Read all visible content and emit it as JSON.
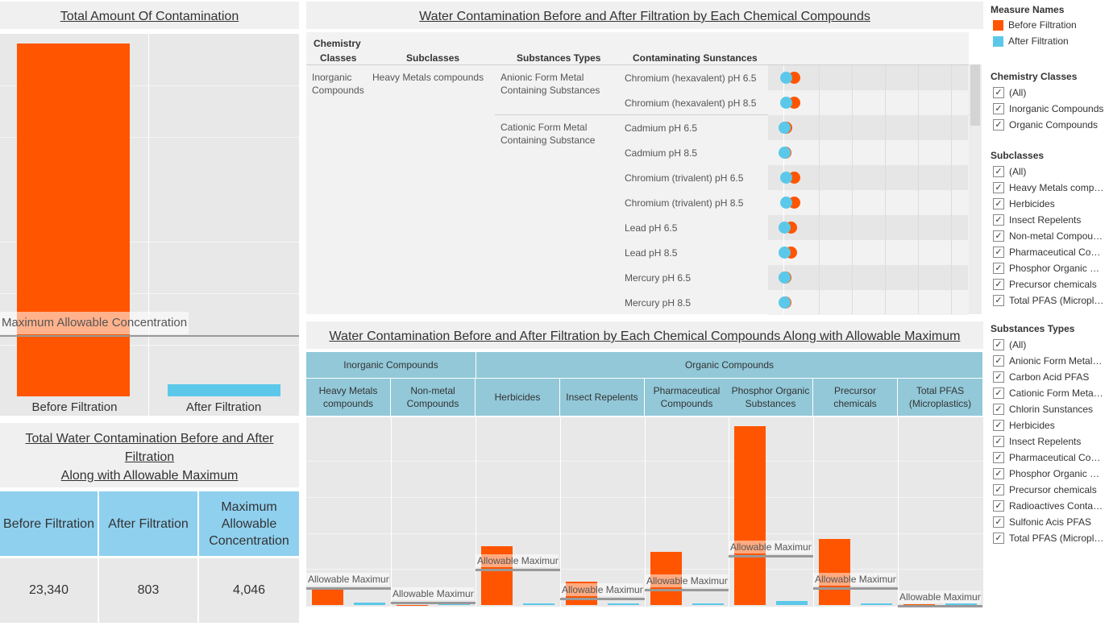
{
  "colors": {
    "before": "#ff5500",
    "after": "#5bc8ea",
    "reference": "#999999",
    "header": "#92c8d8",
    "table_header": "#8fd0ef"
  },
  "panel1": {
    "title": "Total Amount Of Contamination",
    "ref_label": "Maximum Allowable Concentration"
  },
  "panel2": {
    "title": "Water Contamination Before and After Filtration by Each Chemical Compounds",
    "headers": {
      "chem_class_1": "Chemistry",
      "chem_class_2": "Classes",
      "subclass": "Subclasses",
      "sub_type": "Substances Types",
      "contaminating": "Contaminating Sunstances"
    },
    "chem_class_1": "Inorganic",
    "chem_class_2": "Compounds",
    "subclass": "Heavy Metals compounds",
    "type_anionic_1": "Anionic Form Metal",
    "type_anionic_2": "Containing Substances",
    "type_cationic_1": "Cationic Form Metal",
    "type_cationic_2": "Containing Substance"
  },
  "panel3": {
    "title": "Water Contamination Before and After Filtration by Each Chemical Compounds Along with Allowable Maximum",
    "class_inorganic": "Inorganic Compounds",
    "class_organic": "Organic Compounds",
    "ref_label": "Allowable Maximum"
  },
  "panel4": {
    "title_line1": "Total Water Contamination Before and After",
    "title_line2": "Filtration",
    "title_line3": "Along with Allowable Maximum",
    "headers": [
      "Before Filtration",
      "After Filtration",
      "Maximum Allowable Concentration"
    ],
    "values": [
      "23,340",
      "803",
      "4,046"
    ]
  },
  "legend": {
    "title": "Measure Names",
    "items": [
      "Before Filtration",
      "After Filtration"
    ]
  },
  "filters": {
    "chemistry_classes": {
      "title": "Chemistry Classes",
      "items": [
        "(All)",
        "Inorganic Compounds",
        "Organic Compounds"
      ]
    },
    "subclasses": {
      "title": "Subclasses",
      "items": [
        "(All)",
        "Heavy Metals compounds",
        "Herbicides",
        "Insect Repelents",
        "Non-metal Compounds",
        "Pharmaceutical Compounds",
        "Phosphor Organic Substances",
        "Precursor chemicals",
        "Total PFAS (Microplastics)"
      ]
    },
    "substances_types": {
      "title": "Substances Types",
      "items": [
        "(All)",
        "Anionic Form Metal Containing Substances",
        "Carbon Acid PFAS",
        "Cationic Form Metal Containing Substance",
        "Chlorin Sunstances",
        "Herbicides",
        "Insect Repelents",
        "Pharmaceutical Compounds",
        "Phosphor Organic Substances",
        "Precursor chemicals",
        "Radioactives Containing Substances",
        "Sulfonic Acis PFAS",
        "Total PFAS (Microplastics)"
      ]
    }
  },
  "chart_data": [
    {
      "type": "bar",
      "title": "Total Amount Of Contamination",
      "categories": [
        "Before Filtration",
        "After Filtration"
      ],
      "values": [
        23340,
        803
      ],
      "reference_line": {
        "label": "Maximum Allowable Concentration",
        "value": 4046
      },
      "ylim": [
        0,
        24000
      ]
    },
    {
      "type": "scatter",
      "title": "Water Contamination Before and After Filtration by Each Chemical Compounds",
      "rows": [
        {
          "label": "Chromium (hexavalent) pH 6.5",
          "group": "anionic",
          "before": 13,
          "after": 3
        },
        {
          "label": "Chromium (hexavalent) pH 8.5",
          "group": "anionic",
          "before": 13,
          "after": 3
        },
        {
          "label": "Cadmium pH 6.5",
          "group": "cationic",
          "before": 3,
          "after": 0.5
        },
        {
          "label": "Cadmium pH 8.5",
          "group": "cationic",
          "before": 2,
          "after": 0.5
        },
        {
          "label": "Chromium (trivalent) pH 6.5",
          "group": "cationic",
          "before": 13,
          "after": 3
        },
        {
          "label": "Chromium (trivalent) pH 8.5",
          "group": "cationic",
          "before": 13,
          "after": 3
        },
        {
          "label": "Lead pH 6.5",
          "group": "cationic",
          "before": 9,
          "after": 1
        },
        {
          "label": "Lead pH 8.5",
          "group": "cationic",
          "before": 9,
          "after": 1
        },
        {
          "label": "Mercury pH 6.5",
          "group": "cationic",
          "before": 1.5,
          "after": 0.5
        },
        {
          "label": "Mercury pH 8.5",
          "group": "cationic",
          "before": 1.5,
          "after": 0.5
        }
      ]
    },
    {
      "type": "bar",
      "title": "Water Contamination Before and After Filtration by Each Chemical Compounds Along with Allowable Maximum",
      "groups": [
        {
          "class": "Inorganic Compounds",
          "name": "Heavy Metals compounds",
          "line1": "Heavy Metals",
          "line2": "compounds",
          "before": 430,
          "after": 60,
          "max": 480
        },
        {
          "class": "Inorganic Compounds",
          "name": "Non-metal Compounds",
          "line1": "Non-metal",
          "line2": "Compounds",
          "before": 10,
          "after": 5,
          "max": 90
        },
        {
          "class": "Organic Compounds",
          "name": "Herbicides",
          "line1": "Herbicides",
          "line2": "",
          "before": 1620,
          "after": 50,
          "max": 1010
        },
        {
          "class": "Organic Compounds",
          "name": "Insect Repelents",
          "line1": "Insect Repelents",
          "line2": "",
          "before": 640,
          "after": 15,
          "max": 210
        },
        {
          "class": "Organic Compounds",
          "name": "Pharmaceutical Compounds",
          "line1": "Pharmaceutical",
          "line2": "Compounds",
          "before": 1480,
          "after": 45,
          "max": 445
        },
        {
          "class": "Organic Compounds",
          "name": "Phosphor Organic Substances",
          "line1": "Phosphor Organic",
          "line2": "Substances",
          "before": 4960,
          "after": 120,
          "max": 1395
        },
        {
          "class": "Organic Compounds",
          "name": "Precursor chemicals",
          "line1": "Precursor",
          "line2": "chemicals",
          "before": 1830,
          "after": 40,
          "max": 480
        },
        {
          "class": "Organic Compounds",
          "name": "Total PFAS (Microplastics)",
          "line1": "Total PFAS",
          "line2": "(Microplastics)",
          "before": 20,
          "after": 5,
          "max": 10
        }
      ],
      "ylim": [
        0,
        5000
      ]
    }
  ]
}
